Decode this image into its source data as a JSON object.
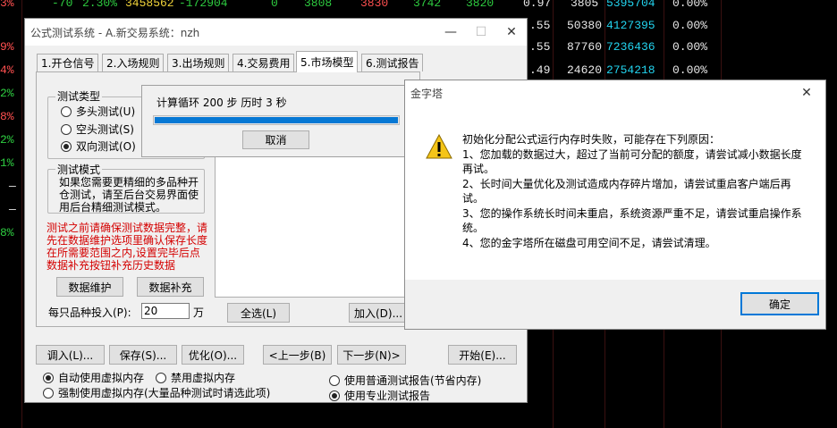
{
  "background_grid": {
    "rows": [
      {
        "pct": "3%",
        "a": "-70",
        "b": "2.30%",
        "c": "3458562",
        "d": "-172904",
        "e": "0",
        "f": "3808",
        "g": "3830",
        "h": "3742",
        "i": "3820",
        "j": "0.97",
        "k": "3805",
        "l": "5395704",
        "m": "0.00%"
      },
      {
        "pct": "",
        "a": "",
        "b": "",
        "c": "",
        "d": "",
        "e": "",
        "f": "",
        "g": "",
        "h": "",
        "i": "",
        "j": ".55",
        "k": "50380",
        "l": "4127395",
        "m": "0.00%"
      },
      {
        "pct": "9%",
        "a": "",
        "b": "",
        "c": "",
        "d": "",
        "e": "",
        "f": "",
        "g": "",
        "h": "",
        "i": "",
        "j": ".55",
        "k": "87760",
        "l": "7236436",
        "m": "0.00%"
      },
      {
        "pct": "4%",
        "a": "",
        "b": "",
        "c": "",
        "d": "",
        "e": "",
        "f": "",
        "g": "",
        "h": "",
        "i": "",
        "j": ".49",
        "k": "24620",
        "l": "2754218",
        "m": "0.00%"
      },
      {
        "pct": "2%",
        "a": "",
        "b": "",
        "c": "",
        "d": "",
        "e": "",
        "f": "",
        "g": "",
        "h": "",
        "i": "",
        "j": "",
        "k": "",
        "l": "",
        "m": ""
      },
      {
        "pct": "8%",
        "a": "",
        "b": "",
        "c": "",
        "d": "",
        "e": "",
        "f": "",
        "g": "",
        "h": "",
        "i": "",
        "j": "",
        "k": "",
        "l": "",
        "m": ""
      },
      {
        "pct": "2%",
        "a": "",
        "b": "",
        "c": "",
        "d": "",
        "e": "",
        "f": "",
        "g": "",
        "h": "",
        "i": "",
        "j": "",
        "k": "",
        "l": "",
        "m": ""
      },
      {
        "pct": "1%",
        "a": "",
        "b": "",
        "c": "",
        "d": "",
        "e": "",
        "f": "",
        "g": "",
        "h": "",
        "i": "",
        "j": "",
        "k": "",
        "l": "",
        "m": ""
      },
      {
        "pct": "—",
        "a": "",
        "b": "",
        "c": "",
        "d": "",
        "e": "",
        "f": "",
        "g": "",
        "h": "",
        "i": "",
        "j": "",
        "k": "",
        "l": "",
        "m": ""
      },
      {
        "pct": "—",
        "a": "",
        "b": "",
        "c": "",
        "d": "",
        "e": "",
        "f": "",
        "g": "",
        "h": "",
        "i": "",
        "j": "",
        "k": "",
        "l": "",
        "m": ""
      },
      {
        "pct": "8%",
        "a": "",
        "b": "",
        "c": "",
        "d": "",
        "e": "",
        "f": "",
        "g": "",
        "h": "",
        "i": "",
        "j": "",
        "k": "",
        "l": "",
        "m": ""
      }
    ]
  },
  "main_window": {
    "title": "公式测试系统 - A.新交易系统：nzh",
    "minimize_icon": "minimize-icon",
    "maximize_icon": "maximize-icon",
    "close_icon": "close-icon",
    "tabs": [
      "1.开仓信号",
      "2.入场规则",
      "3.出场规则",
      "4.交易费用",
      "5.市场模型",
      "6.测试报告"
    ],
    "active_tab": "5.市场模型",
    "test_type": {
      "label": "测试类型",
      "options": [
        "多头测试(U)",
        "空头测试(S)",
        "双向测试(O)"
      ],
      "selected": "双向测试(O)"
    },
    "test_mode": {
      "label": "测试模式",
      "description": "如果您需要更精细的多品种开仓测试，请至后台交易界面使用后台精细测试模式。"
    },
    "warning_text": "测试之前请确保测试数据完整，请先在数据维护选项里确认保存长度在所需要范围之内,设置完毕后点数据补充按钮补充历史数据",
    "data_maintain_button": "数据维护",
    "data_supplement_button": "数据补充",
    "per_item_label": "每只品种投入(P):",
    "per_item_value": "20",
    "per_item_unit": "万",
    "select_all_button": "全选(L)",
    "add_button": "加入(D)...",
    "bottom_buttons": [
      "调入(L)...",
      "保存(S)...",
      "优化(O)...",
      "<上一步(B)",
      "下一步(N)>",
      "开始(E)..."
    ],
    "memory_options": [
      "自动使用虚拟内存",
      "禁用虚拟内存",
      "强制使用虚拟内存(大量品种测试时请选此项)"
    ],
    "memory_selected": "自动使用虚拟内存",
    "report_options": [
      "使用普通测试报告(节省内存)",
      "使用专业测试报告"
    ],
    "report_selected": "使用专业测试报告"
  },
  "progress_dialog": {
    "message": "计算循环 200 步 历时 3 秒",
    "progress_percent": 100,
    "cancel_button": "取消"
  },
  "error_dialog": {
    "title": "金字塔",
    "close_icon": "close-icon",
    "icon": "warning-icon",
    "message_lines": [
      "初始化分配公式运行内存时失败，可能存在下列原因：",
      "1、您加载的数据过大，超过了当前可分配的额度，请尝试减小数据长度再试。",
      "2、长时间大量优化及测试造成内存碎片增加，请尝试重启客户端后再试。",
      "3、您的操作系统长时间未重启，系统资源严重不足，请尝试重启操作系统。",
      "4、您的金字塔所在磁盘可用空间不足，请尝试清理。"
    ],
    "ok_button": "确定"
  },
  "colors": {
    "up": "#ff5050",
    "down": "#2ecc40",
    "accent": "#0078d7",
    "progress": "#0678d4",
    "warning_text": "#d40000"
  }
}
